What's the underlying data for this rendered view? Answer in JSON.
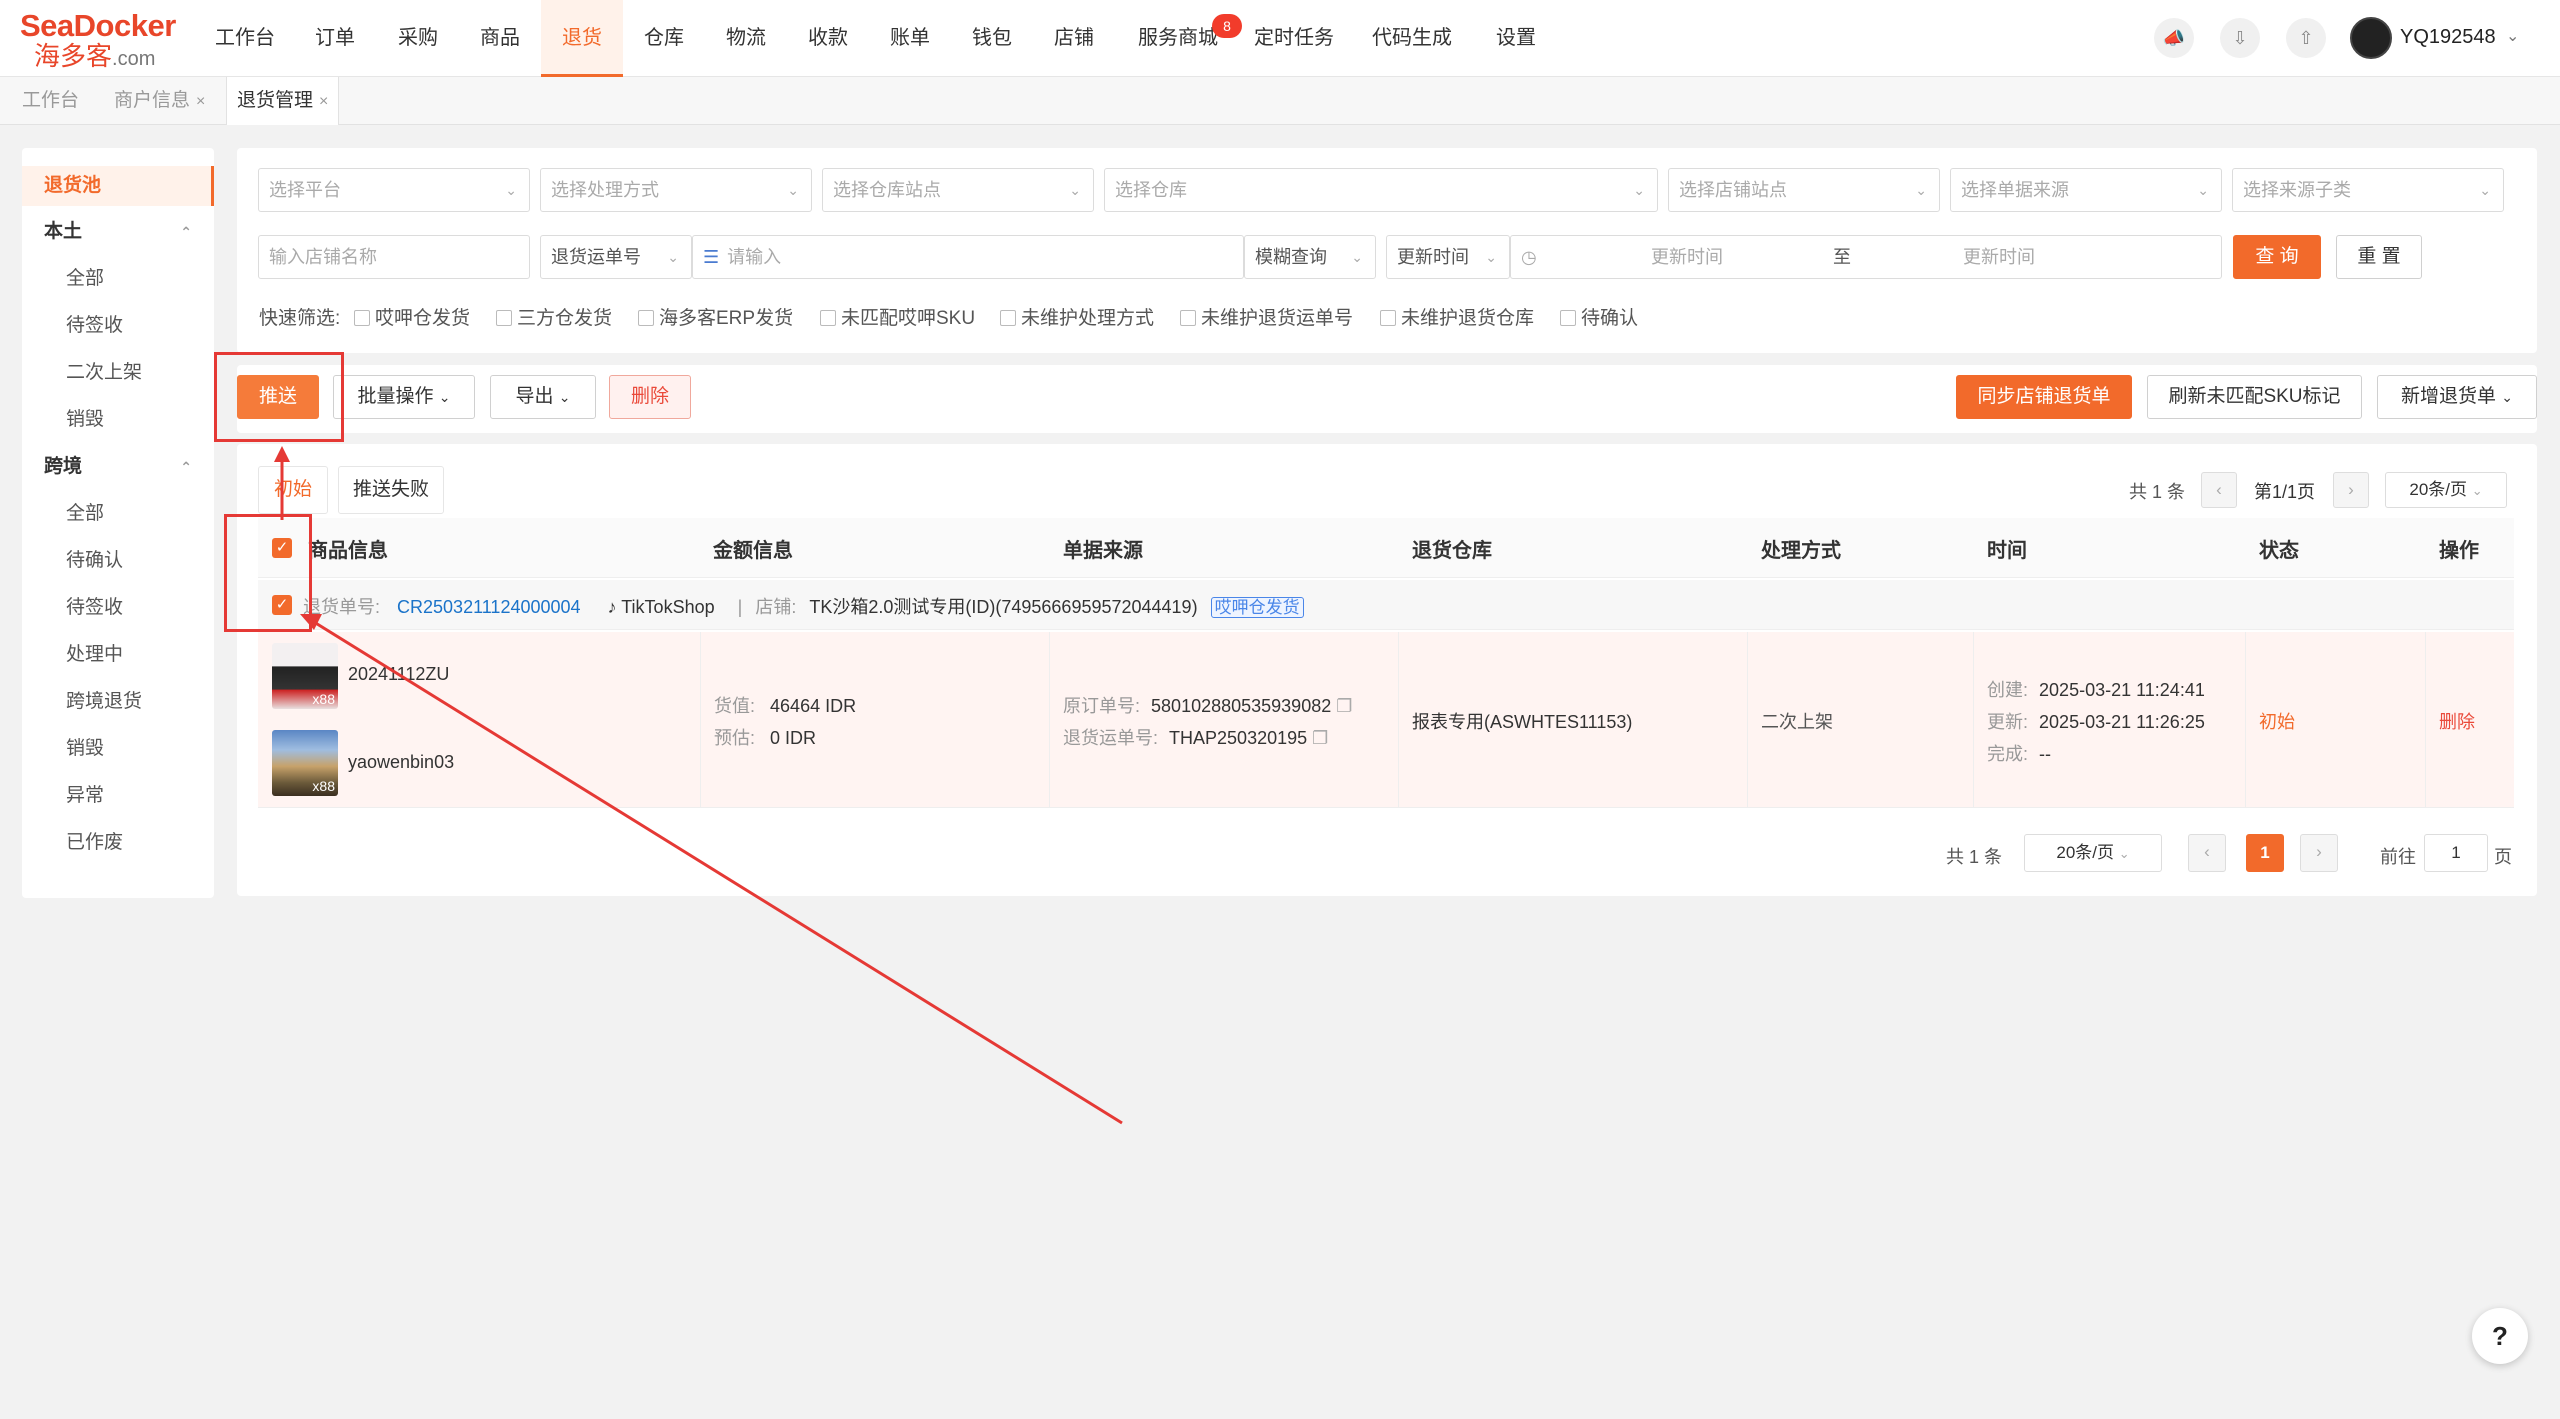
{
  "logo": {
    "brand": "SeaDocker",
    "sub": "海多客",
    "domain": ".com"
  },
  "nav": [
    {
      "label": "工作台"
    },
    {
      "label": "订单"
    },
    {
      "label": "采购"
    },
    {
      "label": "商品"
    },
    {
      "label": "退货"
    },
    {
      "label": "仓库"
    },
    {
      "label": "物流"
    },
    {
      "label": "收款"
    },
    {
      "label": "账单"
    },
    {
      "label": "钱包"
    },
    {
      "label": "店铺"
    },
    {
      "label": "服务商城"
    },
    {
      "label": "定时任务"
    },
    {
      "label": "代码生成"
    },
    {
      "label": "设置"
    }
  ],
  "nav_badge": "8",
  "user": {
    "name": "YQ192548"
  },
  "page_tabs": [
    {
      "label": "工作台"
    },
    {
      "label": "商户信息"
    },
    {
      "label": "退货管理"
    }
  ],
  "sidebar": {
    "active": "退货池",
    "group1": "本土",
    "group1_items": [
      "全部",
      "待签收",
      "二次上架",
      "销毁"
    ],
    "group2": "跨境",
    "group2_items": [
      "全部",
      "待确认",
      "待签收",
      "处理中",
      "跨境退货",
      "销毁",
      "异常",
      "已作废"
    ]
  },
  "filters": {
    "platform": "选择平台",
    "method": "选择处理方式",
    "warehouse_site": "选择仓库站点",
    "warehouse": "选择仓库",
    "shop_site": "选择店铺站点",
    "source": "选择单据来源",
    "source_sub": "选择来源子类",
    "shop_name": "输入店铺名称",
    "number_type": "退货运单号",
    "search_placeholder": "请输入",
    "match": "模糊查询",
    "time_type": "更新时间",
    "time_start": "更新时间",
    "time_to": "至",
    "time_end": "更新时间",
    "search_btn": "查 询",
    "reset_btn": "重 置"
  },
  "quick_filter": {
    "label": "快速筛选:",
    "options": [
      "哎呷仓发货",
      "三方仓发货",
      "海多客ERP发货",
      "未匹配哎呷SKU",
      "未维护处理方式",
      "未维护退货运单号",
      "未维护退货仓库",
      "待确认"
    ]
  },
  "actions": {
    "push": "推送",
    "batch": "批量操作",
    "export": "导出",
    "delete": "删除",
    "sync": "同步店铺退货单",
    "refresh_sku": "刷新未匹配SKU标记",
    "add": "新增退货单"
  },
  "list_tabs": [
    {
      "label": "初始"
    },
    {
      "label": "推送失败"
    }
  ],
  "top_pager": {
    "total": "共 1 条",
    "page": "第1/1页",
    "size": "20条/页"
  },
  "columns": [
    "商品信息",
    "金额信息",
    "单据来源",
    "退货仓库",
    "处理方式",
    "时间",
    "状态",
    "操作"
  ],
  "order": {
    "no_label": "退货单号:",
    "no": "CR2503211124000004",
    "platform": "TikTokShop",
    "shop_label": "店铺:",
    "shop": "TK沙箱2.0测试专用(ID)(7495666959572044419)",
    "tag": "哎呷仓发货",
    "products": [
      {
        "name": "20241112ZU",
        "qty": "x88"
      },
      {
        "name": "yaowenbin03",
        "qty": "x88"
      }
    ],
    "goods_value_label": "货值:",
    "goods_value": "46464 IDR",
    "estimate_label": "预估:",
    "estimate": "0 IDR",
    "orig_no_label": "原订单号:",
    "orig_no": "580102880535939082",
    "ret_ship_label": "退货运单号:",
    "ret_ship": "THAP250320195",
    "warehouse": "报表专用(ASWHTES11153)",
    "method": "二次上架",
    "created_label": "创建:",
    "created": "2025-03-21 11:24:41",
    "updated_label": "更新:",
    "updated": "2025-03-21 11:26:25",
    "done_label": "完成:",
    "done": "--",
    "status": "初始",
    "op": "删除"
  },
  "bottom_pager": {
    "total": "共 1 条",
    "size": "20条/页",
    "current": "1",
    "goto_label": "前往",
    "goto_value": "1",
    "page_unit": "页"
  },
  "help": "?",
  "colors": {
    "accent": "#f26a2b",
    "danger": "#ea4a3a",
    "link": "#1a73c9",
    "annotation": "#e53935"
  }
}
